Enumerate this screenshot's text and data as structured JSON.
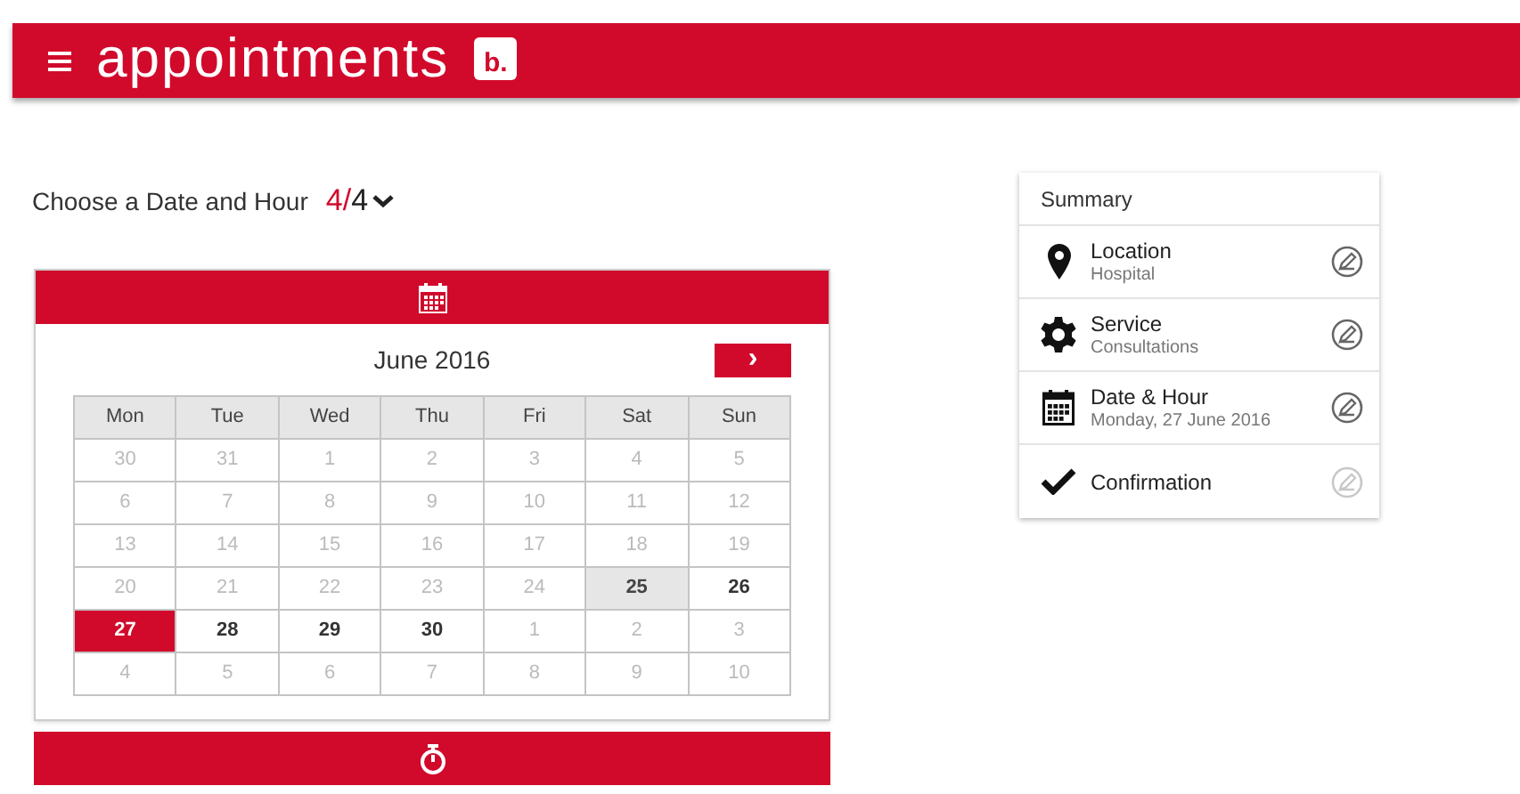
{
  "header": {
    "title": "appointments",
    "logo_letter": "b."
  },
  "step": {
    "label": "Choose a Date and Hour",
    "current": "4",
    "separator": "/",
    "total": "4"
  },
  "calendar": {
    "month": "June 2016",
    "next": "›",
    "weekdays": [
      "Mon",
      "Tue",
      "Wed",
      "Thu",
      "Fri",
      "Sat",
      "Sun"
    ],
    "weeks": [
      [
        {
          "day": "30",
          "enabled": false,
          "selected": false,
          "highlighted": false
        },
        {
          "day": "31",
          "enabled": false,
          "selected": false,
          "highlighted": false
        },
        {
          "day": "1",
          "enabled": false,
          "selected": false,
          "highlighted": false
        },
        {
          "day": "2",
          "enabled": false,
          "selected": false,
          "highlighted": false
        },
        {
          "day": "3",
          "enabled": false,
          "selected": false,
          "highlighted": false
        },
        {
          "day": "4",
          "enabled": false,
          "selected": false,
          "highlighted": false
        },
        {
          "day": "5",
          "enabled": false,
          "selected": false,
          "highlighted": false
        }
      ],
      [
        {
          "day": "6",
          "enabled": false,
          "selected": false,
          "highlighted": false
        },
        {
          "day": "7",
          "enabled": false,
          "selected": false,
          "highlighted": false
        },
        {
          "day": "8",
          "enabled": false,
          "selected": false,
          "highlighted": false
        },
        {
          "day": "9",
          "enabled": false,
          "selected": false,
          "highlighted": false
        },
        {
          "day": "10",
          "enabled": false,
          "selected": false,
          "highlighted": false
        },
        {
          "day": "11",
          "enabled": false,
          "selected": false,
          "highlighted": false
        },
        {
          "day": "12",
          "enabled": false,
          "selected": false,
          "highlighted": false
        }
      ],
      [
        {
          "day": "13",
          "enabled": false,
          "selected": false,
          "highlighted": false
        },
        {
          "day": "14",
          "enabled": false,
          "selected": false,
          "highlighted": false
        },
        {
          "day": "15",
          "enabled": false,
          "selected": false,
          "highlighted": false
        },
        {
          "day": "16",
          "enabled": false,
          "selected": false,
          "highlighted": false
        },
        {
          "day": "17",
          "enabled": false,
          "selected": false,
          "highlighted": false
        },
        {
          "day": "18",
          "enabled": false,
          "selected": false,
          "highlighted": false
        },
        {
          "day": "19",
          "enabled": false,
          "selected": false,
          "highlighted": false
        }
      ],
      [
        {
          "day": "20",
          "enabled": false,
          "selected": false,
          "highlighted": false
        },
        {
          "day": "21",
          "enabled": false,
          "selected": false,
          "highlighted": false
        },
        {
          "day": "22",
          "enabled": false,
          "selected": false,
          "highlighted": false
        },
        {
          "day": "23",
          "enabled": false,
          "selected": false,
          "highlighted": false
        },
        {
          "day": "24",
          "enabled": false,
          "selected": false,
          "highlighted": false
        },
        {
          "day": "25",
          "enabled": true,
          "selected": false,
          "highlighted": true
        },
        {
          "day": "26",
          "enabled": true,
          "selected": false,
          "highlighted": false
        }
      ],
      [
        {
          "day": "27",
          "enabled": true,
          "selected": true,
          "highlighted": false
        },
        {
          "day": "28",
          "enabled": true,
          "selected": false,
          "highlighted": false
        },
        {
          "day": "29",
          "enabled": true,
          "selected": false,
          "highlighted": false
        },
        {
          "day": "30",
          "enabled": true,
          "selected": false,
          "highlighted": false
        },
        {
          "day": "1",
          "enabled": false,
          "selected": false,
          "highlighted": false
        },
        {
          "day": "2",
          "enabled": false,
          "selected": false,
          "highlighted": false
        },
        {
          "day": "3",
          "enabled": false,
          "selected": false,
          "highlighted": false
        }
      ],
      [
        {
          "day": "4",
          "enabled": false,
          "selected": false,
          "highlighted": false
        },
        {
          "day": "5",
          "enabled": false,
          "selected": false,
          "highlighted": false
        },
        {
          "day": "6",
          "enabled": false,
          "selected": false,
          "highlighted": false
        },
        {
          "day": "7",
          "enabled": false,
          "selected": false,
          "highlighted": false
        },
        {
          "day": "8",
          "enabled": false,
          "selected": false,
          "highlighted": false
        },
        {
          "day": "9",
          "enabled": false,
          "selected": false,
          "highlighted": false
        },
        {
          "day": "10",
          "enabled": false,
          "selected": false,
          "highlighted": false
        }
      ]
    ]
  },
  "summary": {
    "title": "Summary",
    "items": [
      {
        "kind": "location",
        "title": "Location",
        "detail": "Hospital",
        "editable": true
      },
      {
        "kind": "service",
        "title": "Service",
        "detail": "Consultations",
        "editable": true
      },
      {
        "kind": "date",
        "title": "Date & Hour",
        "detail": "Monday, 27 June 2016",
        "editable": true
      },
      {
        "kind": "confirmation",
        "title": "Confirmation",
        "editable": false
      }
    ]
  }
}
